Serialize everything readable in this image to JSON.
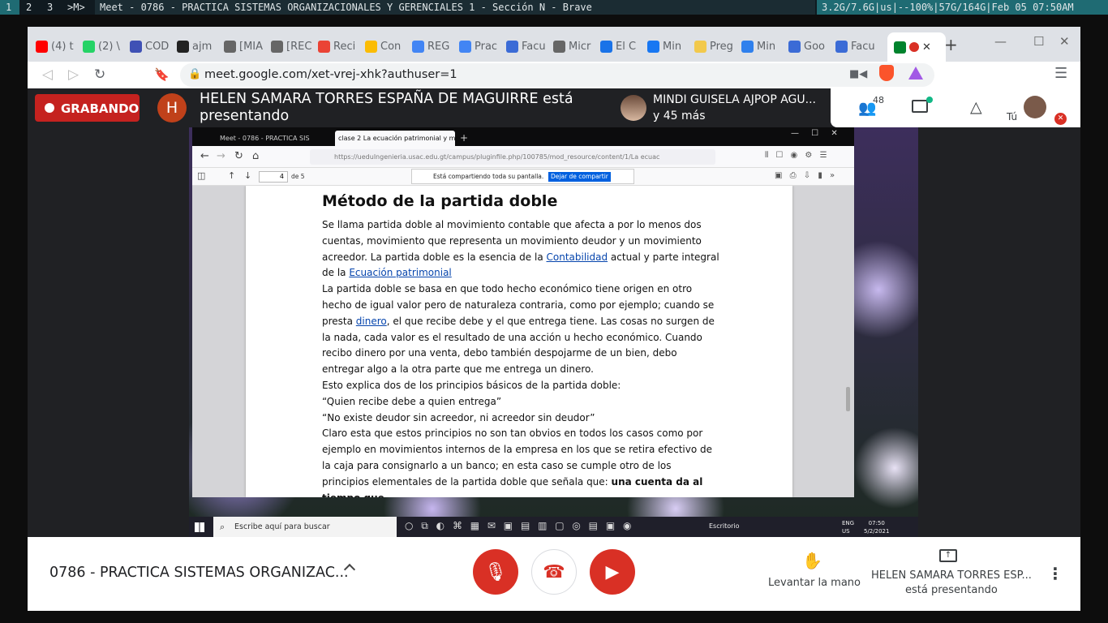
{
  "system_bar": {
    "workspaces": [
      "1",
      "2",
      "3",
      ">M>"
    ],
    "window_title": "Meet - 0786 - PRACTICA SISTEMAS ORGANIZACIONALES Y GERENCIALES 1 - Sección N - Brave",
    "stats": "3.2G/7.6G|us|--100%|57G/164G|Feb 05 07:50AM"
  },
  "browser": {
    "tabs": [
      {
        "label": "(4) t",
        "icon": "youtube-icon",
        "color": "#ff0000"
      },
      {
        "label": "(2) \\",
        "icon": "whatsapp-icon",
        "color": "#25d366"
      },
      {
        "label": "COD",
        "icon": "stack-icon",
        "color": "#3f51b5"
      },
      {
        "label": "ajm",
        "icon": "github-icon",
        "color": "#222222"
      },
      {
        "label": "[MIA",
        "icon": "globe-icon",
        "color": "#666666"
      },
      {
        "label": "[REC",
        "icon": "globe-icon",
        "color": "#666666"
      },
      {
        "label": "Reci",
        "icon": "gmail-icon",
        "color": "#ea4335"
      },
      {
        "label": "Con",
        "icon": "drive-icon",
        "color": "#fbbc04"
      },
      {
        "label": "REG",
        "icon": "docs-icon",
        "color": "#4285f4"
      },
      {
        "label": "Prac",
        "icon": "docs-icon",
        "color": "#4285f4"
      },
      {
        "label": "Facu",
        "icon": "site-icon",
        "color": "#3b6bd6"
      },
      {
        "label": "Micr",
        "icon": "globe-icon",
        "color": "#666666"
      },
      {
        "label": "El C",
        "icon": "g-icon",
        "color": "#1a73e8"
      },
      {
        "label": "Min",
        "icon": "facebook-icon",
        "color": "#1877f2"
      },
      {
        "label": "Preg",
        "icon": "sun-icon",
        "color": "#f2c94c"
      },
      {
        "label": "Min",
        "icon": "bars-icon",
        "color": "#2f80ed"
      },
      {
        "label": "Goo",
        "icon": "site-icon",
        "color": "#3b6bd6"
      },
      {
        "label": "Facu",
        "icon": "site-icon",
        "color": "#3b6bd6"
      }
    ],
    "active_tab_icon": "meet-icon",
    "url": "meet.google.com/xet-vrej-xhk?authuser=1"
  },
  "meet": {
    "recording_label": "GRABANDO",
    "presenter_initial": "H",
    "presenter_banner": "HELEN SAMARA TORRES ESPAÑA DE MAGUIRRE está presentando",
    "participant_name": "MINDI GUISELA AJPOP AGU...",
    "participant_more": "y 45 más",
    "people_count": "48",
    "self_label": "Tú",
    "meeting_title": "0786 - PRACTICA SISTEMAS ORGANIZAC...",
    "raise_hand_label": "Levantar la mano",
    "presenter_name_short": "HELEN SAMARA TORRES ESP...",
    "presenting_label": "está presentando"
  },
  "shared_screen": {
    "tabs": [
      "Meet - 0786 - PRACTICA SIS",
      "clase 2 La ecuación patrimonial y m"
    ],
    "url": "https://uedulngenieria.usac.edu.gt/campus/pluginfile.php/100785/mod_resource/content/1/La ecuac",
    "page_number": "4",
    "page_total": "de 5",
    "share_notice": "Está compartiendo toda su pantalla.",
    "stop_share": "Dejar de compartir",
    "doc_title": "Método de la partida doble",
    "paragraphs": [
      {
        "pre": "Se llama partida doble al movimiento contable que afecta a por lo menos dos cuentas, movimiento que representa un movimiento deudor y un movimiento acreedor. La partida doble es la esencia de la ",
        "link": "Contabilidad",
        "mid": " actual y parte integral de la ",
        "link2": "Ecuación patrimonial",
        "post": ""
      },
      {
        "pre": "La partida doble se basa en que todo hecho económico tiene origen en otro hecho de igual valor pero de naturaleza contraria, como por ejemplo; cuando se presta ",
        "link": "dinero",
        "mid": ", el que recibe debe y el que entrega tiene. Las cosas no surgen de la nada, cada valor es el resultado de una acción u hecho económico. Cuando recibo dinero por una venta, debo también despojarme de un bien, debo entregar algo a la otra parte que me entrega un dinero.",
        "link2": "",
        "post": ""
      }
    ],
    "line_principles": "Esto explica dos de los principios básicos de la partida doble:",
    "quote1": "“Quien recibe debe a quien entrega”",
    "quote2": "“No existe deudor sin acreedor, ni acreedor sin deudor”",
    "last_para": "Claro esta que estos principios no son tan obvios en todos los casos como por ejemplo en movimientos internos de la empresa en los que se retira efectivo de la caja para consignarlo a un banco; en esta caso se cumple otro de los principios elementales de la partida doble que señala que: ",
    "last_bold": "una cuenta da al tiempo que",
    "taskbar_search": "Escribe aquí para buscar",
    "tray_desktop": "Escritorio",
    "tray_lang1": "ENG",
    "tray_lang2": "US",
    "tray_time": "07:50",
    "tray_date": "5/2/2021"
  }
}
